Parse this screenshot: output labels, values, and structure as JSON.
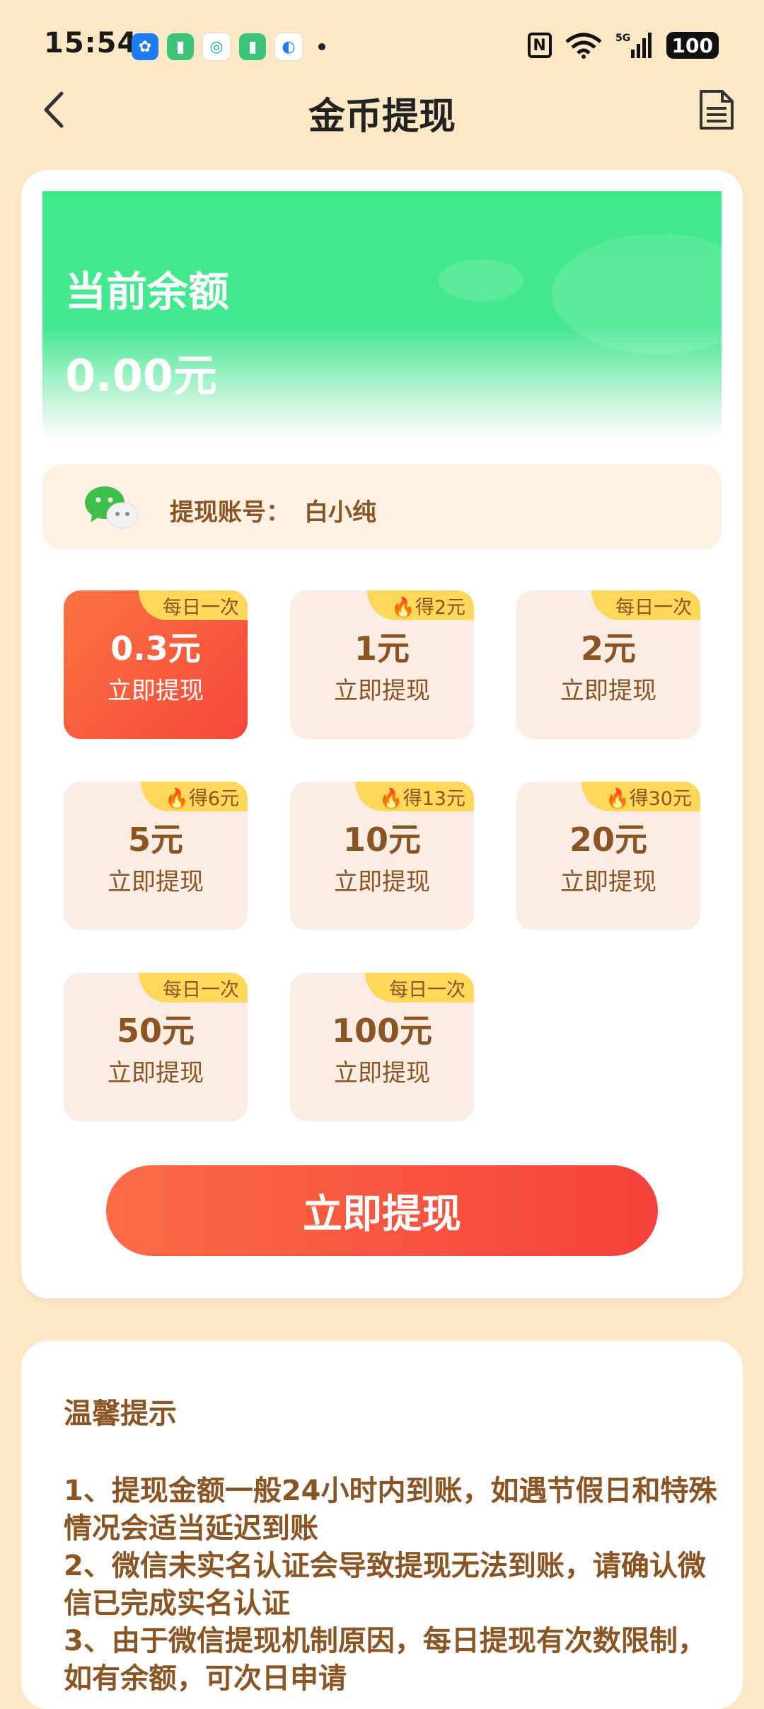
{
  "status_bar": {
    "time": "15:54",
    "battery": "100",
    "signal_label": "5G"
  },
  "header": {
    "title": "金币提现"
  },
  "balance": {
    "label": "当前余额",
    "value": "0.00元"
  },
  "account": {
    "label": "提现账号：",
    "name": "白小纯"
  },
  "options": [
    {
      "tag": "每日一次",
      "amount": "0.3元",
      "action": "立即提现",
      "selected": true
    },
    {
      "tag": "🔥得2元",
      "amount": "1元",
      "action": "立即提现",
      "selected": false
    },
    {
      "tag": "每日一次",
      "amount": "2元",
      "action": "立即提现",
      "selected": false
    },
    {
      "tag": "🔥得6元",
      "amount": "5元",
      "action": "立即提现",
      "selected": false
    },
    {
      "tag": "🔥得13元",
      "amount": "10元",
      "action": "立即提现",
      "selected": false
    },
    {
      "tag": "🔥得30元",
      "amount": "20元",
      "action": "立即提现",
      "selected": false
    },
    {
      "tag": "每日一次",
      "amount": "50元",
      "action": "立即提现",
      "selected": false
    },
    {
      "tag": "每日一次",
      "amount": "100元",
      "action": "立即提现",
      "selected": false
    }
  ],
  "submit": {
    "label": "立即提现"
  },
  "tips": {
    "title": "温馨提示",
    "lines": [
      "1、提现金额一般24小时内到账，如遇节假日和特殊情况会适当延迟到账",
      "2、微信未实名认证会导致提现无法到账，请确认微信已完成实名认证",
      "3、由于微信提现机制原因，每日提现有次数限制，如有余额，可次日申请"
    ]
  },
  "colors": {
    "background": "#fde8c6",
    "accent_red": "#f5473b",
    "accent_green": "#3fe98a",
    "text_brown": "#8a5523",
    "tag_yellow": "#ffd75a"
  }
}
